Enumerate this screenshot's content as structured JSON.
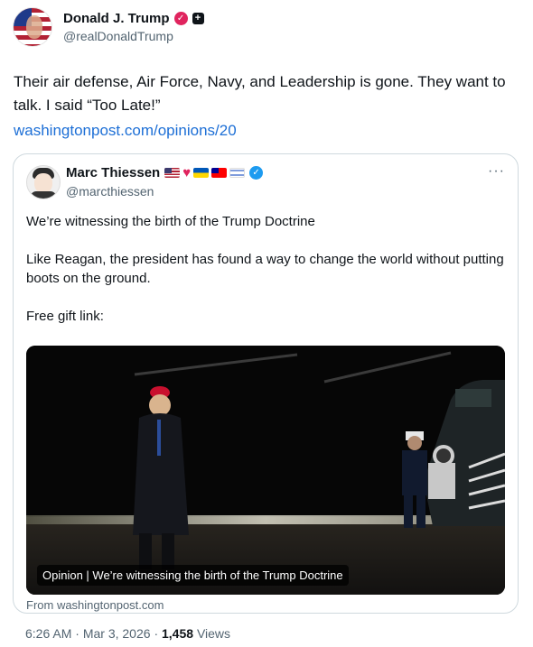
{
  "post": {
    "author_name": "Donald J. Trump",
    "author_handle": "@realDonaldTrump",
    "text": "Their air defense, Air Force, Navy, and Leadership is gone. They want to talk. I said “Too Late!”",
    "link": "washingtonpost.com/opinions/20",
    "time": "6:26 AM",
    "date": "Mar 3, 2026",
    "views_count": "1,458",
    "views_label": "Views",
    "sep": "·"
  },
  "quote": {
    "author_name": "Marc Thiessen",
    "author_handle": "@marcthiessen",
    "more": "···",
    "paragraphs": [
      "We’re witnessing the birth of the Trump Doctrine",
      "Like Reagan, the president has found a way to change the world without putting boots on the ground.",
      "Free gift link:"
    ],
    "media_caption": "Opinion | We’re witnessing the birth of the Trump Doctrine",
    "source": "From washingtonpost.com"
  },
  "icons": {
    "badge_red": "red-affiliate-badge",
    "badge_black": "gov-badge",
    "verified": "verified-check-icon"
  }
}
